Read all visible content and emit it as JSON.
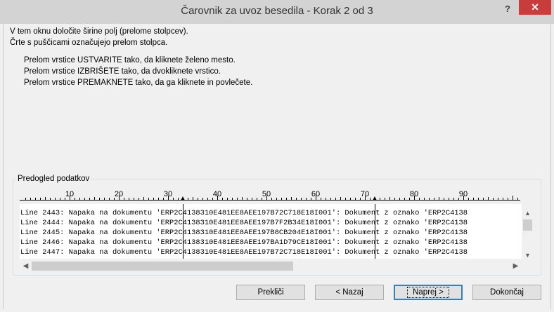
{
  "window": {
    "title": "Čarovnik za uvoz besedila - Korak 2 od 3",
    "help": "?",
    "close": "✕"
  },
  "instructions": {
    "line1": "V tem oknu določite širine polj (prelome stolpcev).",
    "line2": "Črte s puščicami označujejo prelom stolpca."
  },
  "hints": [
    "Prelom vrstice USTVARITE tako, da kliknete želeno mesto.",
    "Prelom vrstice IZBRIŠETE tako, da dvokliknete vrstico.",
    "Prelom vrstice PREMAKNETE tako, da ga kliknete in povlečete."
  ],
  "preview": {
    "label": "Predogled podatkov",
    "ruler_numbers": [
      "10",
      "20",
      "30",
      "40",
      "50",
      "60",
      "70",
      "80",
      "90"
    ],
    "column_breaks_chars": [
      33,
      72
    ],
    "lines": [
      "Line 2443: Napaka na dokumentu 'ERP2C4138310E481EE8AEE197B72C718E18I001': Dokument z oznako 'ERP2C4138",
      "Line 2444: Napaka na dokumentu 'ERP2C4138310E481EE8AEE197B7F2B34E18I001': Dokument z oznako 'ERP2C4138",
      "Line 2445: Napaka na dokumentu 'ERP2C4138310E481EE8AEE197B8CB204E18I001': Dokument z oznako 'ERP2C4138",
      "Line 2446: Napaka na dokumentu 'ERP2C4138310E481EE8AEE197BA1D79CE18I001': Dokument z oznako 'ERP2C4138",
      "Line 2447: Napaka na dokumentu 'ERP2C4138310E481EE8AEE197B72C718E18I001': Dokument z oznako 'ERP2C4138"
    ]
  },
  "buttons": {
    "cancel": "Prekliči",
    "back": "< Nazaj",
    "next": "Naprej >",
    "finish": "Dokončaj"
  }
}
